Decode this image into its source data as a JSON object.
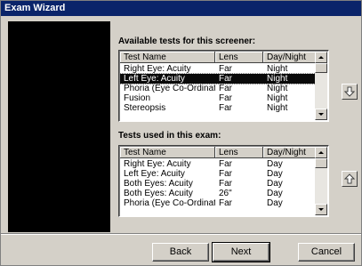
{
  "window": {
    "title": "Exam Wizard"
  },
  "available": {
    "title": "Available tests for this screener:",
    "columns": [
      "Test Name",
      "Lens",
      "Day/Night"
    ],
    "rows": [
      [
        "Right Eye: Acuity",
        "Far",
        "Night"
      ],
      [
        "Left Eye: Acuity",
        "Far",
        "Night"
      ],
      [
        "Phoria (Eye Co-Ordinat...",
        "Far",
        "Night"
      ],
      [
        "Fusion",
        "Far",
        "Night"
      ],
      [
        "Stereopsis",
        "Far",
        "Night"
      ]
    ],
    "selected_index": 1
  },
  "used": {
    "title": "Tests used in this exam:",
    "columns": [
      "Test Name",
      "Lens",
      "Day/Night"
    ],
    "rows": [
      [
        "Right Eye: Acuity",
        "Far",
        "Day"
      ],
      [
        "Left Eye: Acuity",
        "Far",
        "Day"
      ],
      [
        "Both Eyes: Acuity",
        "Far",
        "Day"
      ],
      [
        "Both Eyes: Acuity",
        "26\"",
        "Day"
      ],
      [
        "Phoria (Eye Co-Ordinat...",
        "Far",
        "Day"
      ]
    ]
  },
  "buttons": {
    "back": "Back",
    "next": "Next",
    "cancel": "Cancel"
  },
  "icons": {
    "move_down": "arrow-down-icon",
    "move_up": "arrow-up-icon"
  }
}
